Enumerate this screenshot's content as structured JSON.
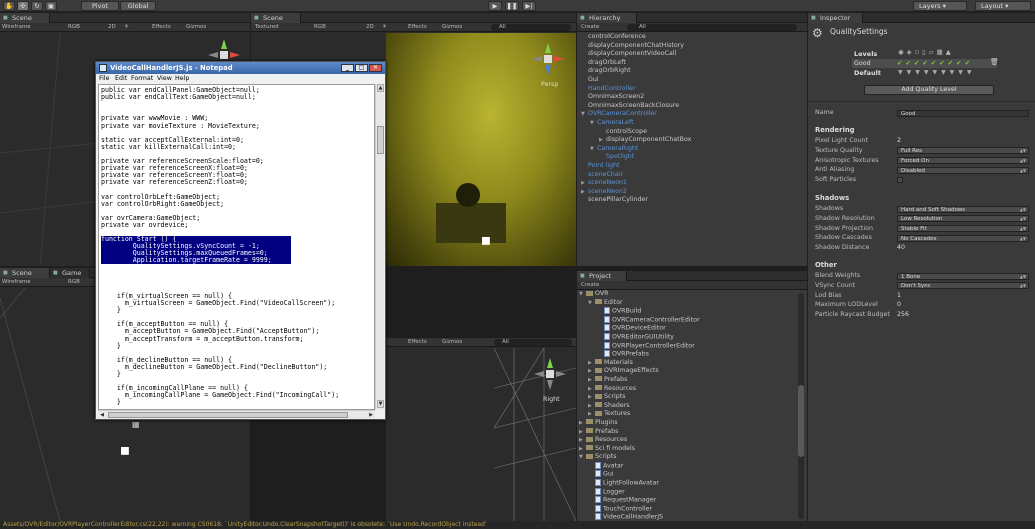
{
  "toolbar": {
    "pivot": "Pivot",
    "global": "Global",
    "layers": "Layers",
    "layout": "Layout"
  },
  "scene_tl": {
    "tab": "Scene",
    "draw_mode": "Wireframe",
    "rgb": "RGB",
    "mode2d": "2D",
    "effects": "Effects",
    "gizmos": "Gizmos"
  },
  "scene_tr": {
    "tab": "Scene",
    "draw_mode": "Textured",
    "rgb": "RGB",
    "mode2d": "2D",
    "effects": "Effects",
    "gizmos": "Gizmos",
    "search_ph": "All",
    "persp": "Persp"
  },
  "scene_bl": {
    "tab_scene": "Scene",
    "tab_game": "Game",
    "draw_mode": "Wireframe",
    "rgb": "RGB"
  },
  "scene_br": {
    "effects": "Effects",
    "gizmos": "Gizmos",
    "search_ph": "All",
    "view": "Right"
  },
  "hierarchy": {
    "tab": "Hierarchy",
    "create": "Create",
    "search_ph": "All",
    "items": [
      {
        "t": "controlConference",
        "d": 0,
        "c": "n"
      },
      {
        "t": "displayComponentChatHistory",
        "d": 0,
        "c": "n"
      },
      {
        "t": "displayComponentVideoCall",
        "d": 0,
        "c": "n"
      },
      {
        "t": "dragOrbLeft",
        "d": 0,
        "c": "n"
      },
      {
        "t": "dragOrbRight",
        "d": 0,
        "c": "n"
      },
      {
        "t": "Gui",
        "d": 0,
        "c": "n"
      },
      {
        "t": "HandController",
        "d": 0,
        "c": "b"
      },
      {
        "t": "OmnimaxScreen2",
        "d": 0,
        "c": "n"
      },
      {
        "t": "OmnimaxScreenBackClosure",
        "d": 0,
        "c": "n"
      },
      {
        "t": "OVRCameraController",
        "d": 0,
        "c": "b",
        "a": "▼"
      },
      {
        "t": "CameraLeft",
        "d": 1,
        "c": "b",
        "a": "▼"
      },
      {
        "t": "controlScope",
        "d": 2,
        "c": "n"
      },
      {
        "t": "displayComponentChatBox",
        "d": 2,
        "c": "n",
        "a": "▶"
      },
      {
        "t": "CameraRight",
        "d": 1,
        "c": "b",
        "a": "▼"
      },
      {
        "t": "Spotlight",
        "d": 2,
        "c": "b"
      },
      {
        "t": "Point light",
        "d": 0,
        "c": "b"
      },
      {
        "t": "sceneChair",
        "d": 0,
        "c": "b"
      },
      {
        "t": "sceneNeon1",
        "d": 0,
        "c": "b",
        "a": "▶"
      },
      {
        "t": "sceneNeon2",
        "d": 0,
        "c": "b",
        "a": "▶"
      },
      {
        "t": "scenePillarCylinder",
        "d": 0,
        "c": "n"
      }
    ]
  },
  "project": {
    "tab": "Project",
    "create": "Create",
    "items": [
      {
        "t": "OVR",
        "d": 0,
        "k": "f",
        "a": "▼"
      },
      {
        "t": "Editor",
        "d": 1,
        "k": "f",
        "a": "▼"
      },
      {
        "t": "OVRBuild",
        "d": 2,
        "k": "s"
      },
      {
        "t": "OVRCameraControllerEditor",
        "d": 2,
        "k": "s"
      },
      {
        "t": "OVRDeviceEditor",
        "d": 2,
        "k": "s"
      },
      {
        "t": "OVREditorGUIUtility",
        "d": 2,
        "k": "s"
      },
      {
        "t": "OVRPlayerControllerEditor",
        "d": 2,
        "k": "s"
      },
      {
        "t": "OVRPrefabs",
        "d": 2,
        "k": "s"
      },
      {
        "t": "Materials",
        "d": 1,
        "k": "f",
        "a": "▶"
      },
      {
        "t": "OVRImageEffects",
        "d": 1,
        "k": "f",
        "a": "▶"
      },
      {
        "t": "Prefabs",
        "d": 1,
        "k": "f",
        "a": "▶"
      },
      {
        "t": "Resources",
        "d": 1,
        "k": "f",
        "a": "▶"
      },
      {
        "t": "Scripts",
        "d": 1,
        "k": "f",
        "a": "▶"
      },
      {
        "t": "Shaders",
        "d": 1,
        "k": "f",
        "a": "▶"
      },
      {
        "t": "Textures",
        "d": 1,
        "k": "f",
        "a": "▶"
      },
      {
        "t": "Plugins",
        "d": 0,
        "k": "f",
        "a": "▶"
      },
      {
        "t": "Prefabs",
        "d": 0,
        "k": "f",
        "a": "▶"
      },
      {
        "t": "Resources",
        "d": 0,
        "k": "f",
        "a": "▶"
      },
      {
        "t": "Sci fi models",
        "d": 0,
        "k": "f",
        "a": "▶"
      },
      {
        "t": "Scripts",
        "d": 0,
        "k": "f",
        "a": "▼"
      },
      {
        "t": "Avatar",
        "d": 1,
        "k": "s"
      },
      {
        "t": "Gui",
        "d": 1,
        "k": "s"
      },
      {
        "t": "LightFollowAvatar",
        "d": 1,
        "k": "s"
      },
      {
        "t": "Logger",
        "d": 1,
        "k": "s"
      },
      {
        "t": "RequestManager",
        "d": 1,
        "k": "s"
      },
      {
        "t": "TouchController",
        "d": 1,
        "k": "s"
      },
      {
        "t": "VideoCallHandlerJS",
        "d": 1,
        "k": "s"
      }
    ]
  },
  "inspector": {
    "tab": "Inspector",
    "title": "QualitySettings",
    "levels_label": "Levels",
    "level_good": "Good",
    "default_label": "Default",
    "add_quality": "Add Quality Level",
    "name_label": "Name",
    "name_value": "Good",
    "rendering": "Rendering",
    "rendering_rows": [
      {
        "l": "Pixel Light Count",
        "v": "2",
        "n": true
      },
      {
        "l": "Texture Quality",
        "v": "Full Res"
      },
      {
        "l": "Anisotropic Textures",
        "v": "Forced On"
      },
      {
        "l": "Anti Aliasing",
        "v": "Disabled"
      },
      {
        "l": "Soft Particles",
        "v": "",
        "cb": true
      }
    ],
    "shadows": "Shadows",
    "shadow_rows": [
      {
        "l": "Shadows",
        "v": "Hard and Soft Shadows"
      },
      {
        "l": "Shadow Resolution",
        "v": "Low Resolution"
      },
      {
        "l": "Shadow Projection",
        "v": "Stable Fit"
      },
      {
        "l": "Shadow Cascades",
        "v": "No Cascades"
      },
      {
        "l": "Shadow Distance",
        "v": "40",
        "n": true
      }
    ],
    "other": "Other",
    "other_rows": [
      {
        "l": "Blend Weights",
        "v": "1 Bone"
      },
      {
        "l": "VSync Count",
        "v": "Don't Sync"
      },
      {
        "l": "Lod Bias",
        "v": "1",
        "n": true
      },
      {
        "l": "Maximum LODLevel",
        "v": "0",
        "n": true
      },
      {
        "l": "Particle Raycast Budget",
        "v": "256",
        "n": true
      }
    ]
  },
  "notepad": {
    "title": "VideoCallHandlerJS.js - Notepad",
    "menu": [
      "File",
      "Edit",
      "Format",
      "View",
      "Help"
    ],
    "lines": [
      "public var endCallPanel:GameObject=null;",
      "public var endCallText:GameObject=null;",
      "",
      "",
      "private var wwwMovie : WWW;",
      "private var movieTexture : MovieTexture;",
      "",
      "static var acceptCallExternal:int=0;",
      "static var killExternalCall:int=0;",
      "",
      "private var referenceScreenScale:float=0;",
      "private var referenceScreenX:float=0;",
      "private var referenceScreenY:float=0;",
      "private var referenceScreenZ:float=0;",
      "",
      "var controlOrbLeft:GameObject;",
      "var controlOrbRight:GameObject;",
      "",
      "var ovrCamera:GameObject;",
      "private var ovrdevice;",
      "",
      "function Start () {",
      "        QualitySettings.vSyncCount = -1;",
      "        QualitySettings.maxQueuedFrames=0;",
      "        Application.targetFrameRate = 9999;",
      "",
      "",
      "",
      "",
      "    if(m_virtualScreen == null) {",
      "      m_virtualScreen = GameObject.Find(\"VideoCallScreen\");",
      "    }",
      "",
      "    if(m_acceptButton == null) {",
      "      m_acceptButton = GameObject.Find(\"AcceptButton\");",
      "      m_acceptTransform = m_acceptButton.transform;",
      "    }",
      "",
      "    if(m_declineButton == null) {",
      "      m_declineButton = GameObject.Find(\"DeclineButton\");",
      "    }",
      "",
      "    if(m_incomingCallPlane == null) {",
      "      m_incomingCallPlane = GameObject.Find(\"IncomingCall\");",
      "    }"
    ],
    "selected": [
      21,
      22,
      23,
      24
    ]
  },
  "status": "Assets/OVR/Editor/OVRPlayerControllerEditor.cs(22,22): warning CS0618: `UnityEditor.Undo.ClearSnapshotTarget()' is obsolete: `Use Undo.RecordObject instead'"
}
